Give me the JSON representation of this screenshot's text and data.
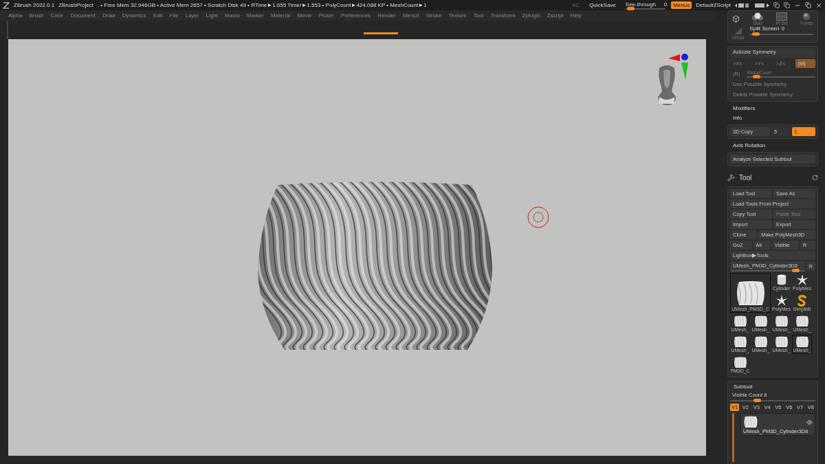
{
  "title_bar": {
    "app": "ZBrush 2022.0.1",
    "project": "ZBrushProject",
    "stats": ". • Free Mem 32.946GB • Active Mem 2657 • Scratch Disk 49 •  RTime►1.655 Timer►1.553 • PolyCount►424.088 KP  • MeshCount►1",
    "ac": "AC",
    "quicksave": "QuickSave",
    "see_through": {
      "label": "See-through",
      "value": "0",
      "level": 0.05
    },
    "menus": {
      "label": "Menus",
      "on": true
    },
    "script": "DefaultZScript"
  },
  "menu": [
    "Alpha",
    "Brush",
    "Color",
    "Document",
    "Draw",
    "Dynamics",
    "Edit",
    "File",
    "Layer",
    "Light",
    "Macro",
    "Marker",
    "Material",
    "Movie",
    "Picker",
    "Preferences",
    "Render",
    "Stencil",
    "Stroke",
    "Texture",
    "Tool",
    "Transform",
    "Zplugin",
    "Zscript",
    "Help"
  ],
  "right_panel": {
    "view_tools": [
      {
        "label": "Solo",
        "kind": "solo"
      },
      {
        "label": "Pt Sel",
        "kind": "ptsel"
      },
      {
        "label": "Transp",
        "kind": "transp"
      },
      {
        "label": "Ghost",
        "kind": "ghost"
      }
    ],
    "split_screen": {
      "label": "Split Screen",
      "value": "0",
      "level": 0.05
    },
    "symmetry": {
      "title": "Activate Symmetry",
      "axes": [
        {
          "label": ">X<",
          "on": false
        },
        {
          "label": ">Y<",
          "on": false
        },
        {
          "label": ">Z<",
          "on": false
        },
        {
          "label": "(M)",
          "on": true
        }
      ],
      "radial": {
        "label": "(R)",
        "slider": "RadialCount",
        "level": 0.1
      },
      "actions": [
        {
          "label": "Use Posable Symmetry",
          "disabled": true
        },
        {
          "label": "Delete Posable Symmetry",
          "disabled": true
        }
      ]
    },
    "sections": [
      "Modifiers",
      "Info"
    ],
    "copy": {
      "label": "3D Copy",
      "value": "5",
      "input": "1"
    },
    "axis_rotation": "Axis Rotation",
    "analyze": "Analyze Selected Subtool",
    "tool": {
      "title": "Tool",
      "rows": [
        [
          {
            "label": "Load Tool",
            "disabled": false
          },
          {
            "label": "Save As",
            "disabled": false
          }
        ],
        [
          {
            "label": "Load Tools From Project",
            "disabled": false
          }
        ],
        [
          {
            "label": "Copy Tool",
            "disabled": false
          },
          {
            "label": "Paste Tool",
            "disabled": true
          }
        ],
        [
          {
            "label": "Import",
            "disabled": false
          },
          {
            "label": "Export",
            "disabled": false
          }
        ],
        [
          {
            "label": "Clone",
            "disabled": false
          },
          {
            "label": "Make PolyMesh3D",
            "disabled": false
          }
        ],
        [
          {
            "label": "GoZ",
            "disabled": false
          },
          {
            "label": "All",
            "disabled": false
          },
          {
            "label": "Visible",
            "disabled": false
          },
          {
            "label": "R",
            "disabled": false
          }
        ],
        [
          {
            "label": "Lightbox▶Tools",
            "disabled": false
          }
        ]
      ],
      "current": {
        "name": "UMesh_PM3D_Cylinder3D8",
        "button": "R",
        "level": 0.92
      },
      "thumbnails": [
        {
          "label": "UMesh_PM3D_C",
          "kind": "vase_large",
          "selected": true
        },
        {
          "label": "Cylinder",
          "kind": "cylinder",
          "selected": false
        },
        {
          "label": "PolyMes",
          "kind": "star",
          "selected": false
        },
        {
          "label": "PolyMes",
          "kind": "star",
          "selected": false
        },
        {
          "label": "SimpleB",
          "kind": "snake",
          "selected": false
        },
        {
          "label": "UMesh_",
          "kind": "vase",
          "selected": false
        },
        {
          "label": "UMesh_",
          "kind": "vase",
          "selected": false
        },
        {
          "label": "UMesh_",
          "kind": "vase",
          "selected": false
        },
        {
          "label": "UMesh_",
          "kind": "vase",
          "selected": false
        },
        {
          "label": "UMesh_",
          "kind": "vase",
          "selected": false
        },
        {
          "label": "UMesh_",
          "kind": "vase",
          "selected": false
        },
        {
          "label": "UMesh_",
          "kind": "vase",
          "selected": false
        },
        {
          "label": "UMesh_",
          "kind": "vase",
          "selected": true
        },
        {
          "label": "PM3D_C",
          "kind": "vase",
          "selected": false
        }
      ]
    },
    "subtool": {
      "title": "Subtool",
      "visible_count": {
        "label": "Visible Count 8",
        "level": 0.3
      },
      "tabs": [
        {
          "label": "V1",
          "selected": true
        },
        {
          "label": "V2",
          "selected": false
        },
        {
          "label": "V3",
          "selected": false
        },
        {
          "label": "V4",
          "selected": false
        },
        {
          "label": "V5",
          "selected": false
        },
        {
          "label": "V6",
          "selected": false
        },
        {
          "label": "V7",
          "selected": false
        },
        {
          "label": "V8",
          "selected": false
        }
      ],
      "item": {
        "name": "UMesh_PM3D_Cylinder3D8"
      }
    }
  }
}
